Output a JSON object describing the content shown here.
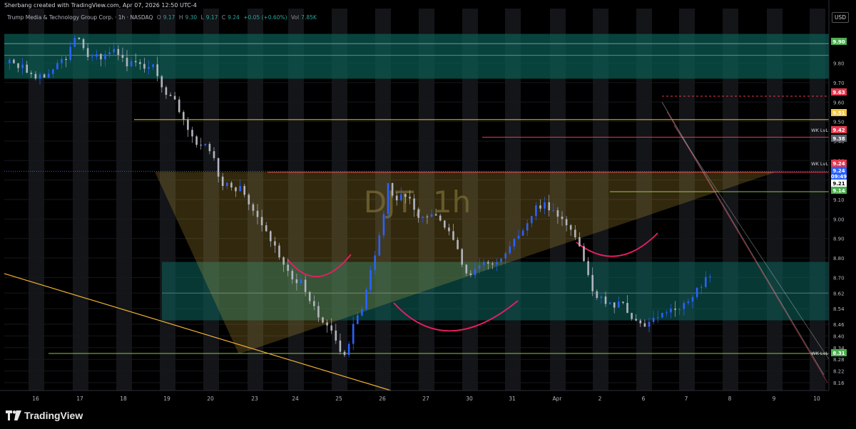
{
  "header": {
    "credit": "Sherbang created with TradingView.com, Apr 07, 2026 12:50 UTC-4"
  },
  "symbol": {
    "name": "Trump Media & Technology Group Corp. · 1h · NASDAQ",
    "o_label": "O",
    "o_value": "9.17",
    "h_label": "H",
    "h_value": "9.30",
    "l_label": "L",
    "l_value": "9.17",
    "c_label": "C",
    "c_value": "9.24",
    "change": "+0.05 (+0.60%)",
    "vol_label": "Vol",
    "vol_value": "7.85K"
  },
  "currency": "USD",
  "watermark": "DJT, 1h",
  "brand": "TradingView",
  "colors": {
    "background": "#000000",
    "up_candle": "#2962ff",
    "down_candle": "#b2b5be",
    "zone": "#0b5e56",
    "triangle": "#f5c542",
    "trendline": "#f0b232",
    "support": "#8bc34a",
    "resistance": "#e53950",
    "arc": "#e91e63"
  },
  "chart_data": {
    "type": "candlestick",
    "x_ticks": [
      "16",
      "17",
      "18",
      "19",
      "20",
      "23",
      "24",
      "25",
      "26",
      "27",
      "30",
      "31",
      "Apr",
      "2",
      "6",
      "7",
      "8",
      "9",
      "10"
    ],
    "y_ticks": [
      9.8,
      9.7,
      9.6,
      9.5,
      9.4,
      9.3,
      9.2,
      9.1,
      9.0,
      8.9,
      8.8,
      8.7,
      8.62,
      8.54,
      8.46,
      8.4,
      8.34,
      8.28,
      8.22,
      8.16
    ],
    "y_range": [
      8.12,
      10.08
    ],
    "price_labels": [
      {
        "value": "9.90",
        "color": "#4caf50"
      },
      {
        "value": "9.63",
        "color": "#e53950"
      },
      {
        "value": "9.51",
        "color": "#f5c542"
      },
      {
        "value": "9.42",
        "color": "#e53950"
      },
      {
        "value": "9.38",
        "color": "#5d606b"
      },
      {
        "value": "9.24",
        "color": "#e53950"
      },
      {
        "value": "9.24",
        "color": "#2962ff"
      },
      {
        "value": "09:49",
        "color": "#2962ff"
      },
      {
        "value": "9.21",
        "color": "#000000"
      },
      {
        "value": "9.14",
        "color": "#4caf50"
      },
      {
        "value": "8.31",
        "color": "#4caf50"
      }
    ],
    "annotations": [
      "WK LvL",
      "WK LvL",
      "WK LvL"
    ],
    "zones": [
      [
        9.72,
        9.95
      ],
      [
        8.48,
        8.78
      ]
    ],
    "horizontal_levels": [
      9.9,
      9.84,
      9.63,
      9.51,
      9.42,
      9.24,
      9.14,
      8.62,
      8.31
    ],
    "candle_path": [
      [
        0,
        9.8
      ],
      [
        4,
        9.75
      ],
      [
        7,
        9.9
      ],
      [
        9,
        9.84
      ],
      [
        12,
        9.83
      ],
      [
        16,
        9.78
      ],
      [
        19,
        9.55
      ],
      [
        22,
        9.35
      ],
      [
        24,
        9.2
      ],
      [
        27,
        9.1
      ],
      [
        30,
        8.85
      ],
      [
        33,
        8.65
      ],
      [
        36,
        8.45
      ],
      [
        38,
        8.33
      ],
      [
        40,
        8.55
      ],
      [
        43,
        9.15
      ],
      [
        46,
        9.05
      ],
      [
        49,
        9.0
      ],
      [
        52,
        8.75
      ],
      [
        55,
        8.8
      ],
      [
        58,
        8.9
      ],
      [
        61,
        9.1
      ],
      [
        64,
        8.95
      ],
      [
        67,
        8.6
      ],
      [
        70,
        8.55
      ],
      [
        73,
        8.45
      ],
      [
        76,
        8.5
      ],
      [
        78,
        8.58
      ],
      [
        80,
        8.7
      ],
      [
        83,
        9.18
      ],
      [
        86,
        9.3
      ],
      [
        89,
        9.15
      ],
      [
        92,
        9.05
      ],
      [
        95,
        9.0
      ],
      [
        97,
        8.82
      ],
      [
        99,
        8.94
      ],
      [
        102,
        9.22
      ],
      [
        105,
        9.26
      ],
      [
        107,
        9.18
      ],
      [
        109,
        9.2
      ]
    ]
  }
}
